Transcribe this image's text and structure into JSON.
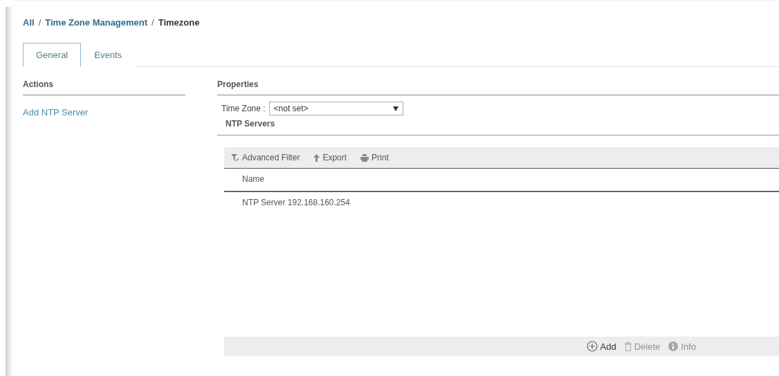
{
  "breadcrumb": [
    {
      "label": "All",
      "current": false
    },
    {
      "label": "Time Zone Management",
      "current": false
    },
    {
      "label": "Timezone",
      "current": true
    }
  ],
  "breadcrumb_separator": "/",
  "tabs": [
    {
      "label": "General",
      "selected": true
    },
    {
      "label": "Events",
      "selected": false
    }
  ],
  "actions": {
    "title": "Actions",
    "items": [
      "Add NTP Server"
    ]
  },
  "properties": {
    "title": "Properties",
    "time_zone": {
      "label": "Time Zone :",
      "value": "<not set>"
    }
  },
  "ntp_servers": {
    "title": "NTP Servers",
    "toolbar": [
      {
        "kind": "filter",
        "label": "Advanced Filter"
      },
      {
        "kind": "export",
        "label": "Export"
      },
      {
        "kind": "print",
        "label": "Print"
      }
    ],
    "columns": [
      "Name"
    ],
    "rows": [
      "NTP Server 192.168.160.254"
    ],
    "footer": [
      {
        "kind": "add",
        "label": "Add",
        "disabled": false
      },
      {
        "kind": "delete",
        "label": "Delete",
        "disabled": true
      },
      {
        "kind": "info",
        "label": "Info",
        "disabled": true
      }
    ]
  }
}
